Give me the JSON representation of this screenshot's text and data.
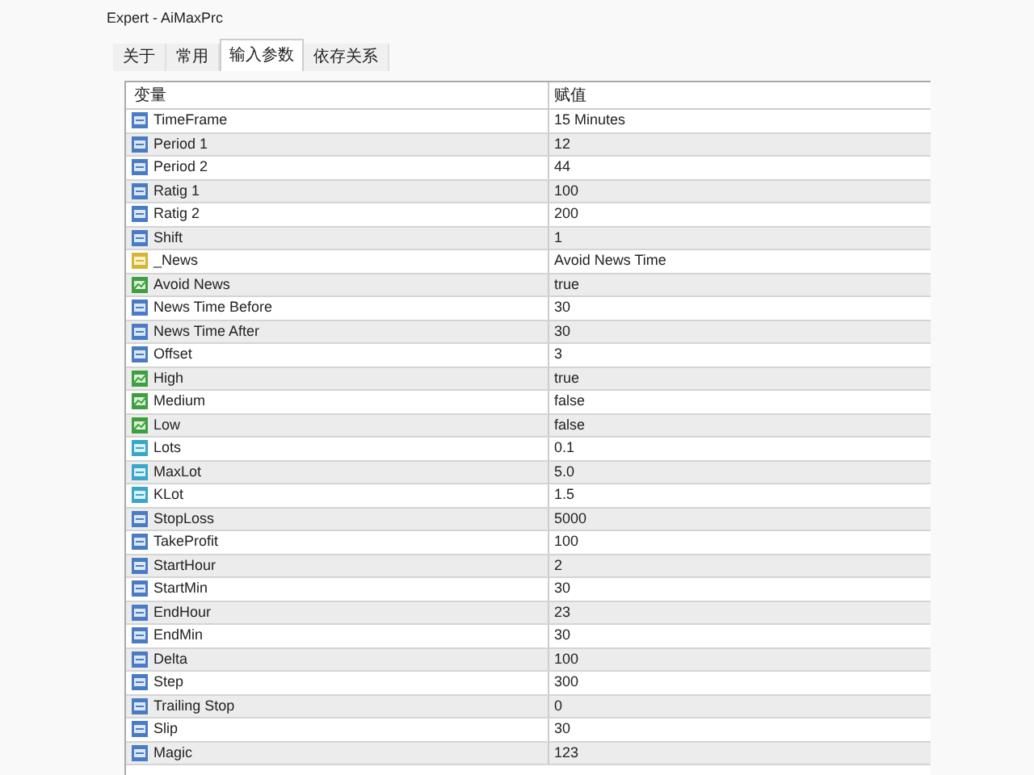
{
  "window": {
    "title": "Expert - AiMaxPrc"
  },
  "tabs": [
    {
      "label": "关于",
      "selected": false
    },
    {
      "label": "常用",
      "selected": false
    },
    {
      "label": "输入参数",
      "selected": true
    },
    {
      "label": "依存关系",
      "selected": false
    }
  ],
  "table": {
    "columns": [
      "变量",
      "赋值"
    ],
    "rows": [
      {
        "kind": "int",
        "name": "TimeFrame",
        "value": "15 Minutes"
      },
      {
        "kind": "int",
        "name": "Period 1",
        "value": "12"
      },
      {
        "kind": "int",
        "name": "Period 2",
        "value": "44"
      },
      {
        "kind": "int",
        "name": "Ratig 1",
        "value": "100"
      },
      {
        "kind": "int",
        "name": "Ratig 2",
        "value": "200"
      },
      {
        "kind": "int",
        "name": "Shift",
        "value": "1"
      },
      {
        "kind": "string",
        "name": "_News",
        "value": "Avoid News Time"
      },
      {
        "kind": "bool",
        "name": "Avoid News",
        "value": "true"
      },
      {
        "kind": "int",
        "name": "News Time Before",
        "value": "30"
      },
      {
        "kind": "int",
        "name": "News Time After",
        "value": "30"
      },
      {
        "kind": "int",
        "name": "Offset",
        "value": "3"
      },
      {
        "kind": "bool",
        "name": "High",
        "value": "true"
      },
      {
        "kind": "bool",
        "name": "Medium",
        "value": "false"
      },
      {
        "kind": "bool",
        "name": "Low",
        "value": "false"
      },
      {
        "kind": "double",
        "name": "Lots",
        "value": "0.1"
      },
      {
        "kind": "double",
        "name": "MaxLot",
        "value": "5.0"
      },
      {
        "kind": "double",
        "name": "KLot",
        "value": "1.5"
      },
      {
        "kind": "int",
        "name": "StopLoss",
        "value": "5000"
      },
      {
        "kind": "int",
        "name": "TakeProfit",
        "value": "100"
      },
      {
        "kind": "int",
        "name": "StartHour",
        "value": "2"
      },
      {
        "kind": "int",
        "name": "StartMin",
        "value": "30"
      },
      {
        "kind": "int",
        "name": "EndHour",
        "value": "23"
      },
      {
        "kind": "int",
        "name": "EndMin",
        "value": "30"
      },
      {
        "kind": "int",
        "name": "Delta",
        "value": "100"
      },
      {
        "kind": "int",
        "name": "Step",
        "value": "300"
      },
      {
        "kind": "int",
        "name": "Trailing Stop",
        "value": "0"
      },
      {
        "kind": "int",
        "name": "Slip",
        "value": "30"
      },
      {
        "kind": "int",
        "name": "Magic",
        "value": "123"
      }
    ]
  }
}
